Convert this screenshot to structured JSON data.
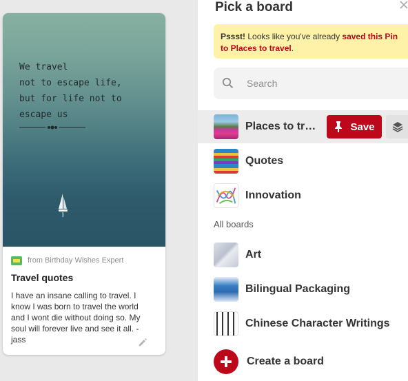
{
  "pin": {
    "quote_text": "We travel\nnot to escape life,\nbut for life not to\nescape us",
    "source": "from Birthday Wishes Expert",
    "title": "Travel quotes",
    "description": "I have an insane calling to travel. I know I was born to travel the world and I wont die without doing so. My soul will forever live and see it all. -jass"
  },
  "panel": {
    "title": "Pick a board",
    "notice": {
      "prefix": "Pssst!",
      "middle": " Looks like you've already ",
      "highlight": "saved this Pin to Places to travel",
      "suffix": "."
    },
    "search_placeholder": "Search",
    "recent_boards": [
      {
        "name": "Places to travel",
        "thumb": "places"
      },
      {
        "name": "Quotes",
        "thumb": "quotes"
      },
      {
        "name": "Innovation",
        "thumb": "innovation"
      }
    ],
    "save_label": "Save",
    "all_boards_label": "All boards",
    "all_boards": [
      {
        "name": "Art",
        "thumb": "art"
      },
      {
        "name": "Bilingual Packaging",
        "thumb": "bilingual"
      },
      {
        "name": "Chinese Character Writings",
        "thumb": "chinese"
      }
    ],
    "create_label": "Create a board"
  },
  "colors": {
    "accent": "#bd081c",
    "notice_bg": "#fdf2a8",
    "page_bg": "#e9e9e9"
  },
  "icons": [
    "pencil-icon",
    "close-icon",
    "search-icon",
    "pushpin-icon",
    "layers-icon",
    "plus-icon"
  ]
}
